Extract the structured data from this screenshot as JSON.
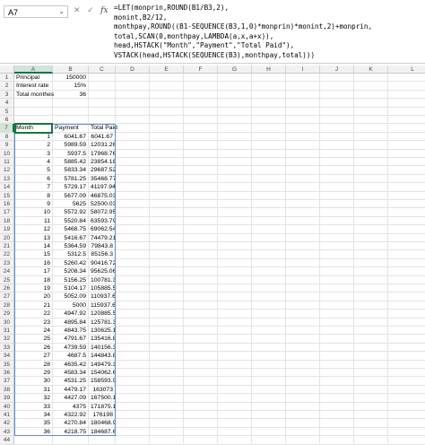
{
  "name_box": {
    "value": "A7",
    "dropdown_icon": "chevron-down-icon"
  },
  "formula_bar": {
    "cancel_icon": "✕",
    "enter_icon": "✓",
    "fx_label": "fx",
    "lines": [
      "=LET(monprin,ROUND(B1/B3,2),",
      "monint,B2/12,",
      "monthpay,ROUND((B1-SEQUENCE(B3,1,0)*monprin)*monint,2)+monprin,",
      "total,SCAN(0,monthpay,LAMBDA(a,x,a+x)),",
      "head,HSTACK(\"Month\",\"Payment\",\"Total Paid\"),",
      "VSTACK(head,HSTACK(SEQUENCE(B3),monthpay,total)))"
    ]
  },
  "columns": [
    "A",
    "B",
    "C",
    "D",
    "E",
    "F",
    "G",
    "H",
    "I",
    "J",
    "K",
    "L"
  ],
  "selected_column": "A",
  "selected_row": "7",
  "inputs": [
    {
      "label": "Principal",
      "value": "150000"
    },
    {
      "label": "Interest rate",
      "value": "15%"
    },
    {
      "label": "Total monthes",
      "value": "36"
    }
  ],
  "table": {
    "headers": [
      "Month",
      "Payment",
      "Total Paid"
    ],
    "rows": [
      [
        "1",
        "6041.67",
        "6041.67"
      ],
      [
        "2",
        "5989.59",
        "12031.26"
      ],
      [
        "3",
        "5937.5",
        "17968.76"
      ],
      [
        "4",
        "5885.42",
        "23854.18"
      ],
      [
        "5",
        "5833.34",
        "29687.52"
      ],
      [
        "6",
        "5781.25",
        "35468.77"
      ],
      [
        "7",
        "5729.17",
        "41197.94"
      ],
      [
        "8",
        "5677.09",
        "46875.03"
      ],
      [
        "9",
        "5625",
        "52500.03"
      ],
      [
        "10",
        "5572.92",
        "58072.95"
      ],
      [
        "11",
        "5520.84",
        "63593.79"
      ],
      [
        "12",
        "5468.75",
        "69062.54"
      ],
      [
        "13",
        "5416.67",
        "74479.21"
      ],
      [
        "14",
        "5364.59",
        "79843.8"
      ],
      [
        "15",
        "5312.5",
        "85156.3"
      ],
      [
        "16",
        "5260.42",
        "90416.72"
      ],
      [
        "17",
        "5208.34",
        "95625.06"
      ],
      [
        "18",
        "5156.25",
        "100781.3"
      ],
      [
        "19",
        "5104.17",
        "105885.5"
      ],
      [
        "20",
        "5052.09",
        "110937.6"
      ],
      [
        "21",
        "5000",
        "115937.6"
      ],
      [
        "22",
        "4947.92",
        "120885.5"
      ],
      [
        "23",
        "4895.84",
        "125781.3"
      ],
      [
        "24",
        "4843.75",
        "130625.1"
      ],
      [
        "25",
        "4791.67",
        "135416.8"
      ],
      [
        "26",
        "4739.59",
        "140156.3"
      ],
      [
        "27",
        "4687.5",
        "144843.8"
      ],
      [
        "28",
        "4635.42",
        "149479.3"
      ],
      [
        "29",
        "4583.34",
        "154062.6"
      ],
      [
        "30",
        "4531.25",
        "158593.9"
      ],
      [
        "31",
        "4479.17",
        "163073"
      ],
      [
        "32",
        "4427.09",
        "167500.1"
      ],
      [
        "33",
        "4375",
        "171875.1"
      ],
      [
        "34",
        "4322.92",
        "176198"
      ],
      [
        "35",
        "4270.84",
        "180468.9"
      ],
      [
        "36",
        "4218.75",
        "184687.6"
      ]
    ]
  },
  "row_numbers": [
    "1",
    "2",
    "3",
    "4",
    "5",
    "6",
    "7",
    "8",
    "9",
    "10",
    "11",
    "12",
    "13",
    "14",
    "15",
    "16",
    "17",
    "18",
    "19",
    "20",
    "21",
    "22",
    "23",
    "24",
    "25",
    "26",
    "27",
    "28",
    "29",
    "30",
    "31",
    "32",
    "33",
    "34",
    "35",
    "36",
    "37",
    "38",
    "39",
    "40",
    "41",
    "42",
    "43",
    "44"
  ],
  "colors": {
    "accent": "#1a7343",
    "spill": "#5b8fd6"
  }
}
